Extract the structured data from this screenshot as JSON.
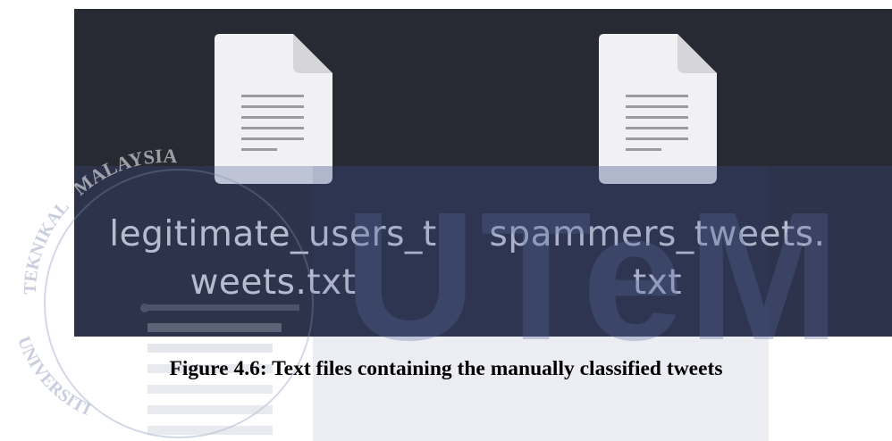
{
  "files": [
    {
      "icon": "text-file-icon",
      "name_line1": "legitimate_users_t",
      "name_line2": "weets.txt"
    },
    {
      "icon": "text-file-icon",
      "name_line1": "spammers_tweets.",
      "name_line2": "txt"
    }
  ],
  "caption": "Figure 4.6: Text files containing the manually classified tweets",
  "watermark": {
    "logo_text": "UTeM",
    "seal_top_text": "MALAYSIA",
    "seal_left_text": "TEKNIKAL",
    "seal_bottom_text": "UNIVERSITI"
  },
  "colors": {
    "panel_background": "#282a33",
    "file_label": "#e7e7ea",
    "icon_page": "#f1f1f3",
    "watermark_blue": "#3a4a8a"
  }
}
